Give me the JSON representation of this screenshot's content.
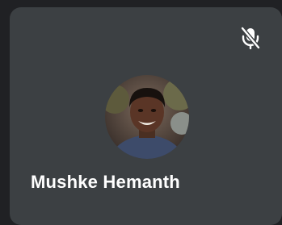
{
  "participant": {
    "name": "Mushke Hemanth",
    "mic_status": "muted",
    "mic_icon": "microphone-off-icon",
    "avatar_icon": "profile-photo"
  },
  "colors": {
    "page_background": "#202124",
    "tile_background": "#3c4043",
    "text": "#ffffff"
  }
}
